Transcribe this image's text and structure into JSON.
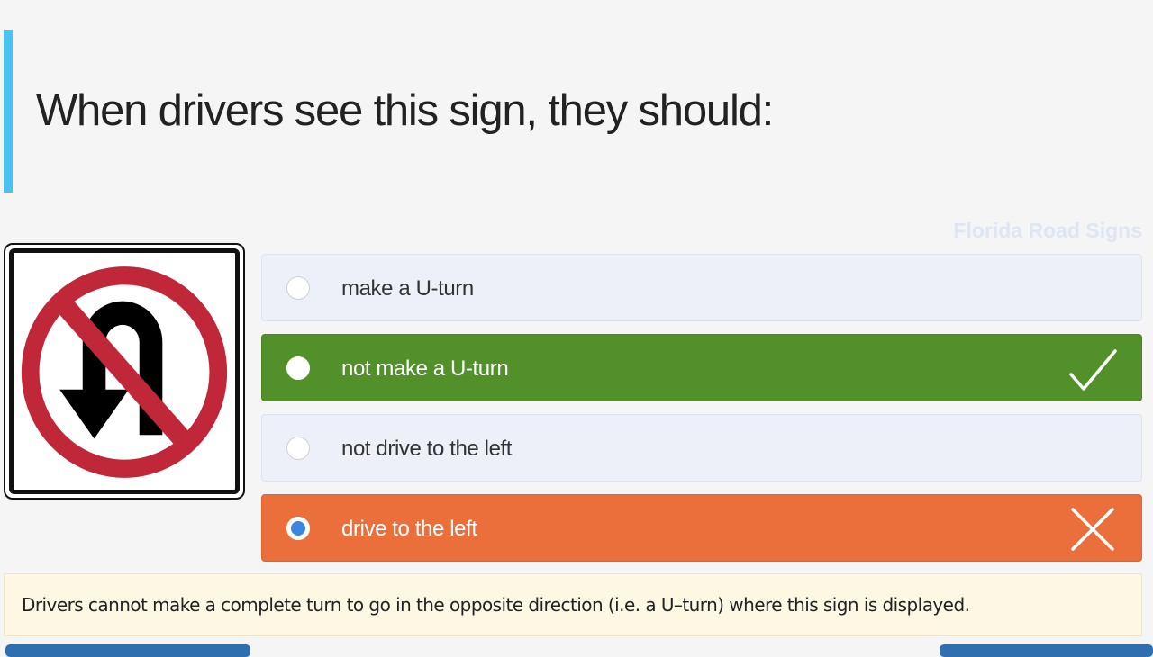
{
  "question": {
    "title": "When drivers see this sign, they should:",
    "accent_color": "#49c3ef"
  },
  "category": {
    "label": "Florida Road Signs"
  },
  "sign": {
    "icon": "no-u-turn-sign",
    "ring_color": "#c0283a"
  },
  "options": [
    {
      "label": "make a U-turn",
      "state": "neutral",
      "selected": false
    },
    {
      "label": "not make a U-turn",
      "state": "correct",
      "selected": false,
      "mark_icon": "checkmark-icon"
    },
    {
      "label": "not drive to the left",
      "state": "neutral",
      "selected": false
    },
    {
      "label": "drive to the left",
      "state": "wrong",
      "selected": true,
      "mark_icon": "x-mark-icon"
    }
  ],
  "colors": {
    "correct": "#52912a",
    "wrong": "#ea6f3b",
    "neutral": "#edf0f8",
    "radio_selected": "#3b86e0",
    "explanation_bg": "#fdf7e4"
  },
  "explanation": {
    "text": "Drivers cannot make a complete turn to go in the opposite direction (i.e. a U–turn) where this sign is displayed."
  }
}
